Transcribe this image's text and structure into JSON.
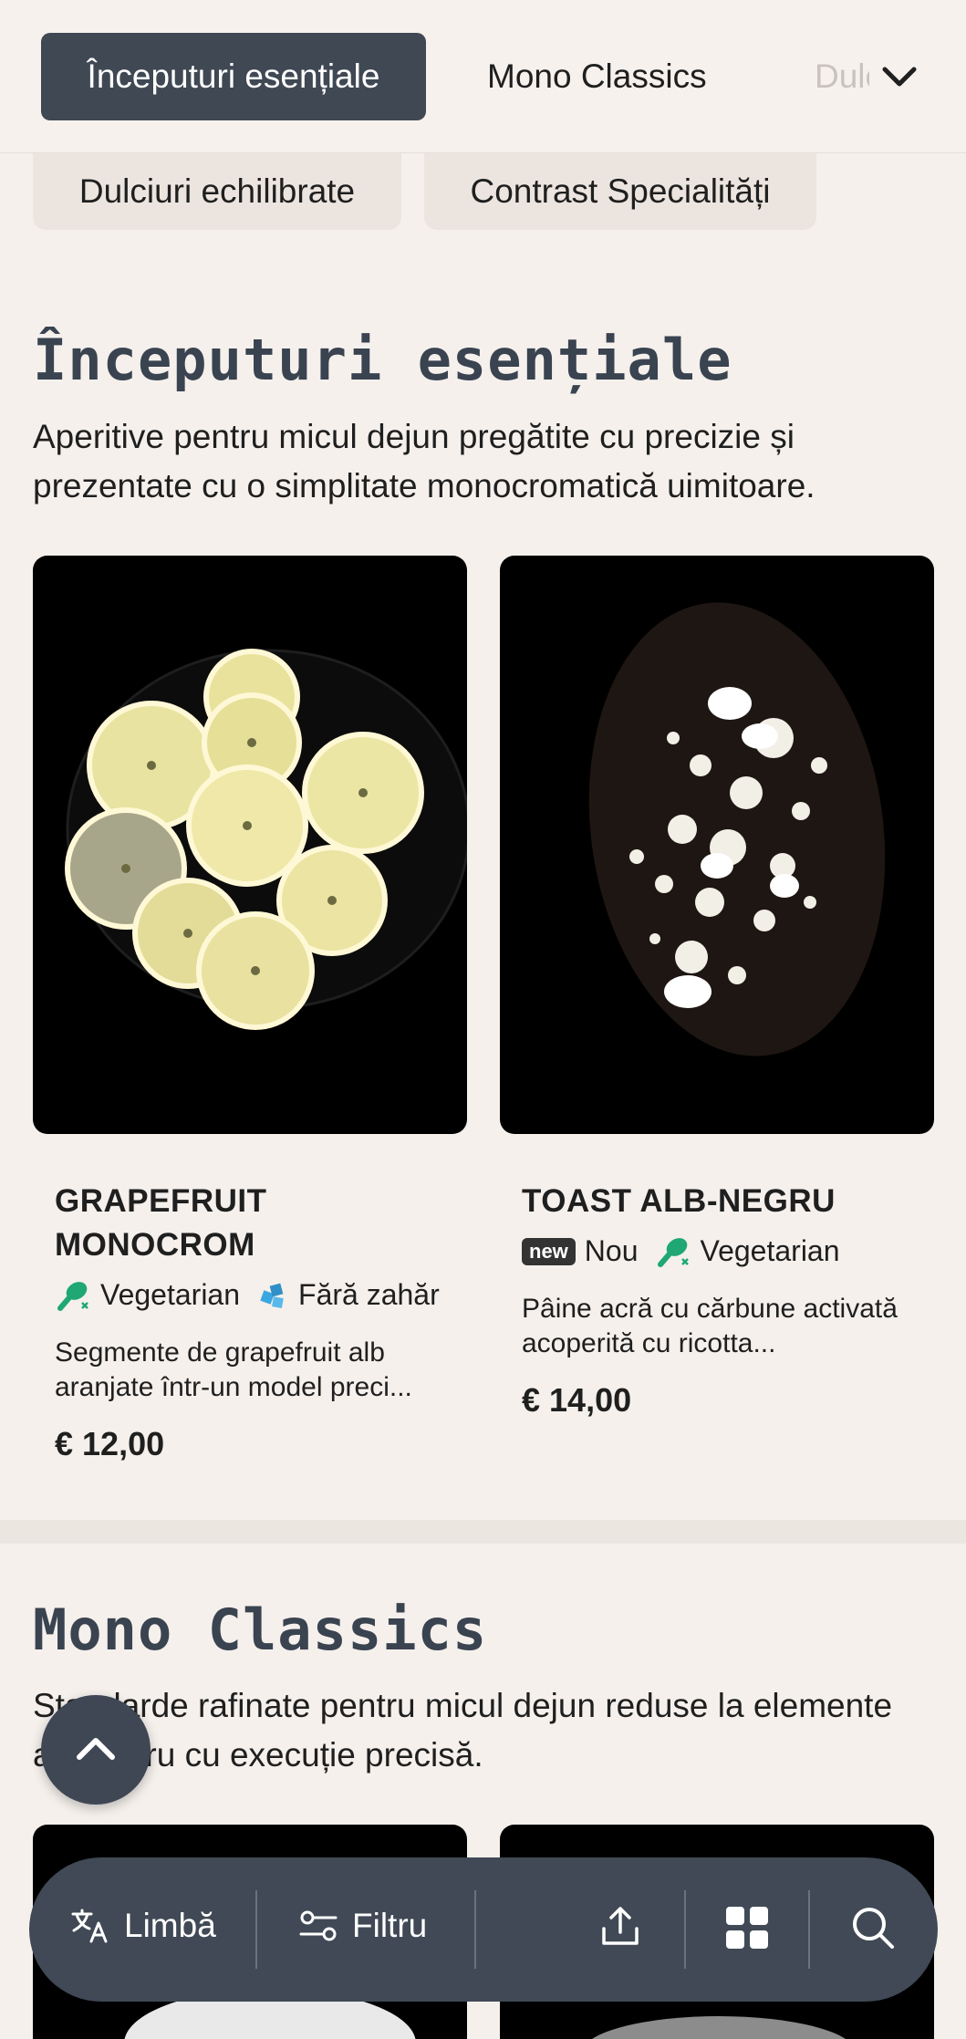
{
  "nav": {
    "active_tab": "Începuturi esențiale",
    "tab_mono": "Mono Classics",
    "tab_faded": "Dulciuri echilibrate",
    "chips": [
      "Dulciuri echilibrate",
      "Contrast Specialități"
    ]
  },
  "section1": {
    "title": "Începuturi esențiale",
    "description": "Aperitive pentru micul dejun pregătite cu precizie și prezentate cu o simplitate monocromatică uimitoare.",
    "cards": [
      {
        "name": "GRAPEFRUIT MONOCROM",
        "tag1": "Vegetarian",
        "tag2": "Fără zahăr",
        "description": "Segmente de grapefruit alb aranjate într-un model preci...",
        "price": "€ 12,00"
      },
      {
        "name": "TOAST ALB-NEGRU",
        "badge": "new",
        "tag1": "Nou",
        "tag2": "Vegetarian",
        "description": "Pâine acră cu cărbune activată acoperită cu ricotta...",
        "price": "€ 14,00"
      }
    ]
  },
  "section2": {
    "title": "Mono Classics",
    "description": "Standarde rafinate pentru micul dejun reduse la elemente alb-negru cu execuție precisă."
  },
  "toolbar": {
    "language_label": "Limbă",
    "filter_label": "Filtru"
  },
  "icons": {
    "vegetarian": "drumstick-leaf-icon",
    "sugar_free": "sugar-free-icon",
    "accent_green": "#1fa774",
    "accent_blue": "#3aa7e0",
    "dark": "#3f4853"
  }
}
